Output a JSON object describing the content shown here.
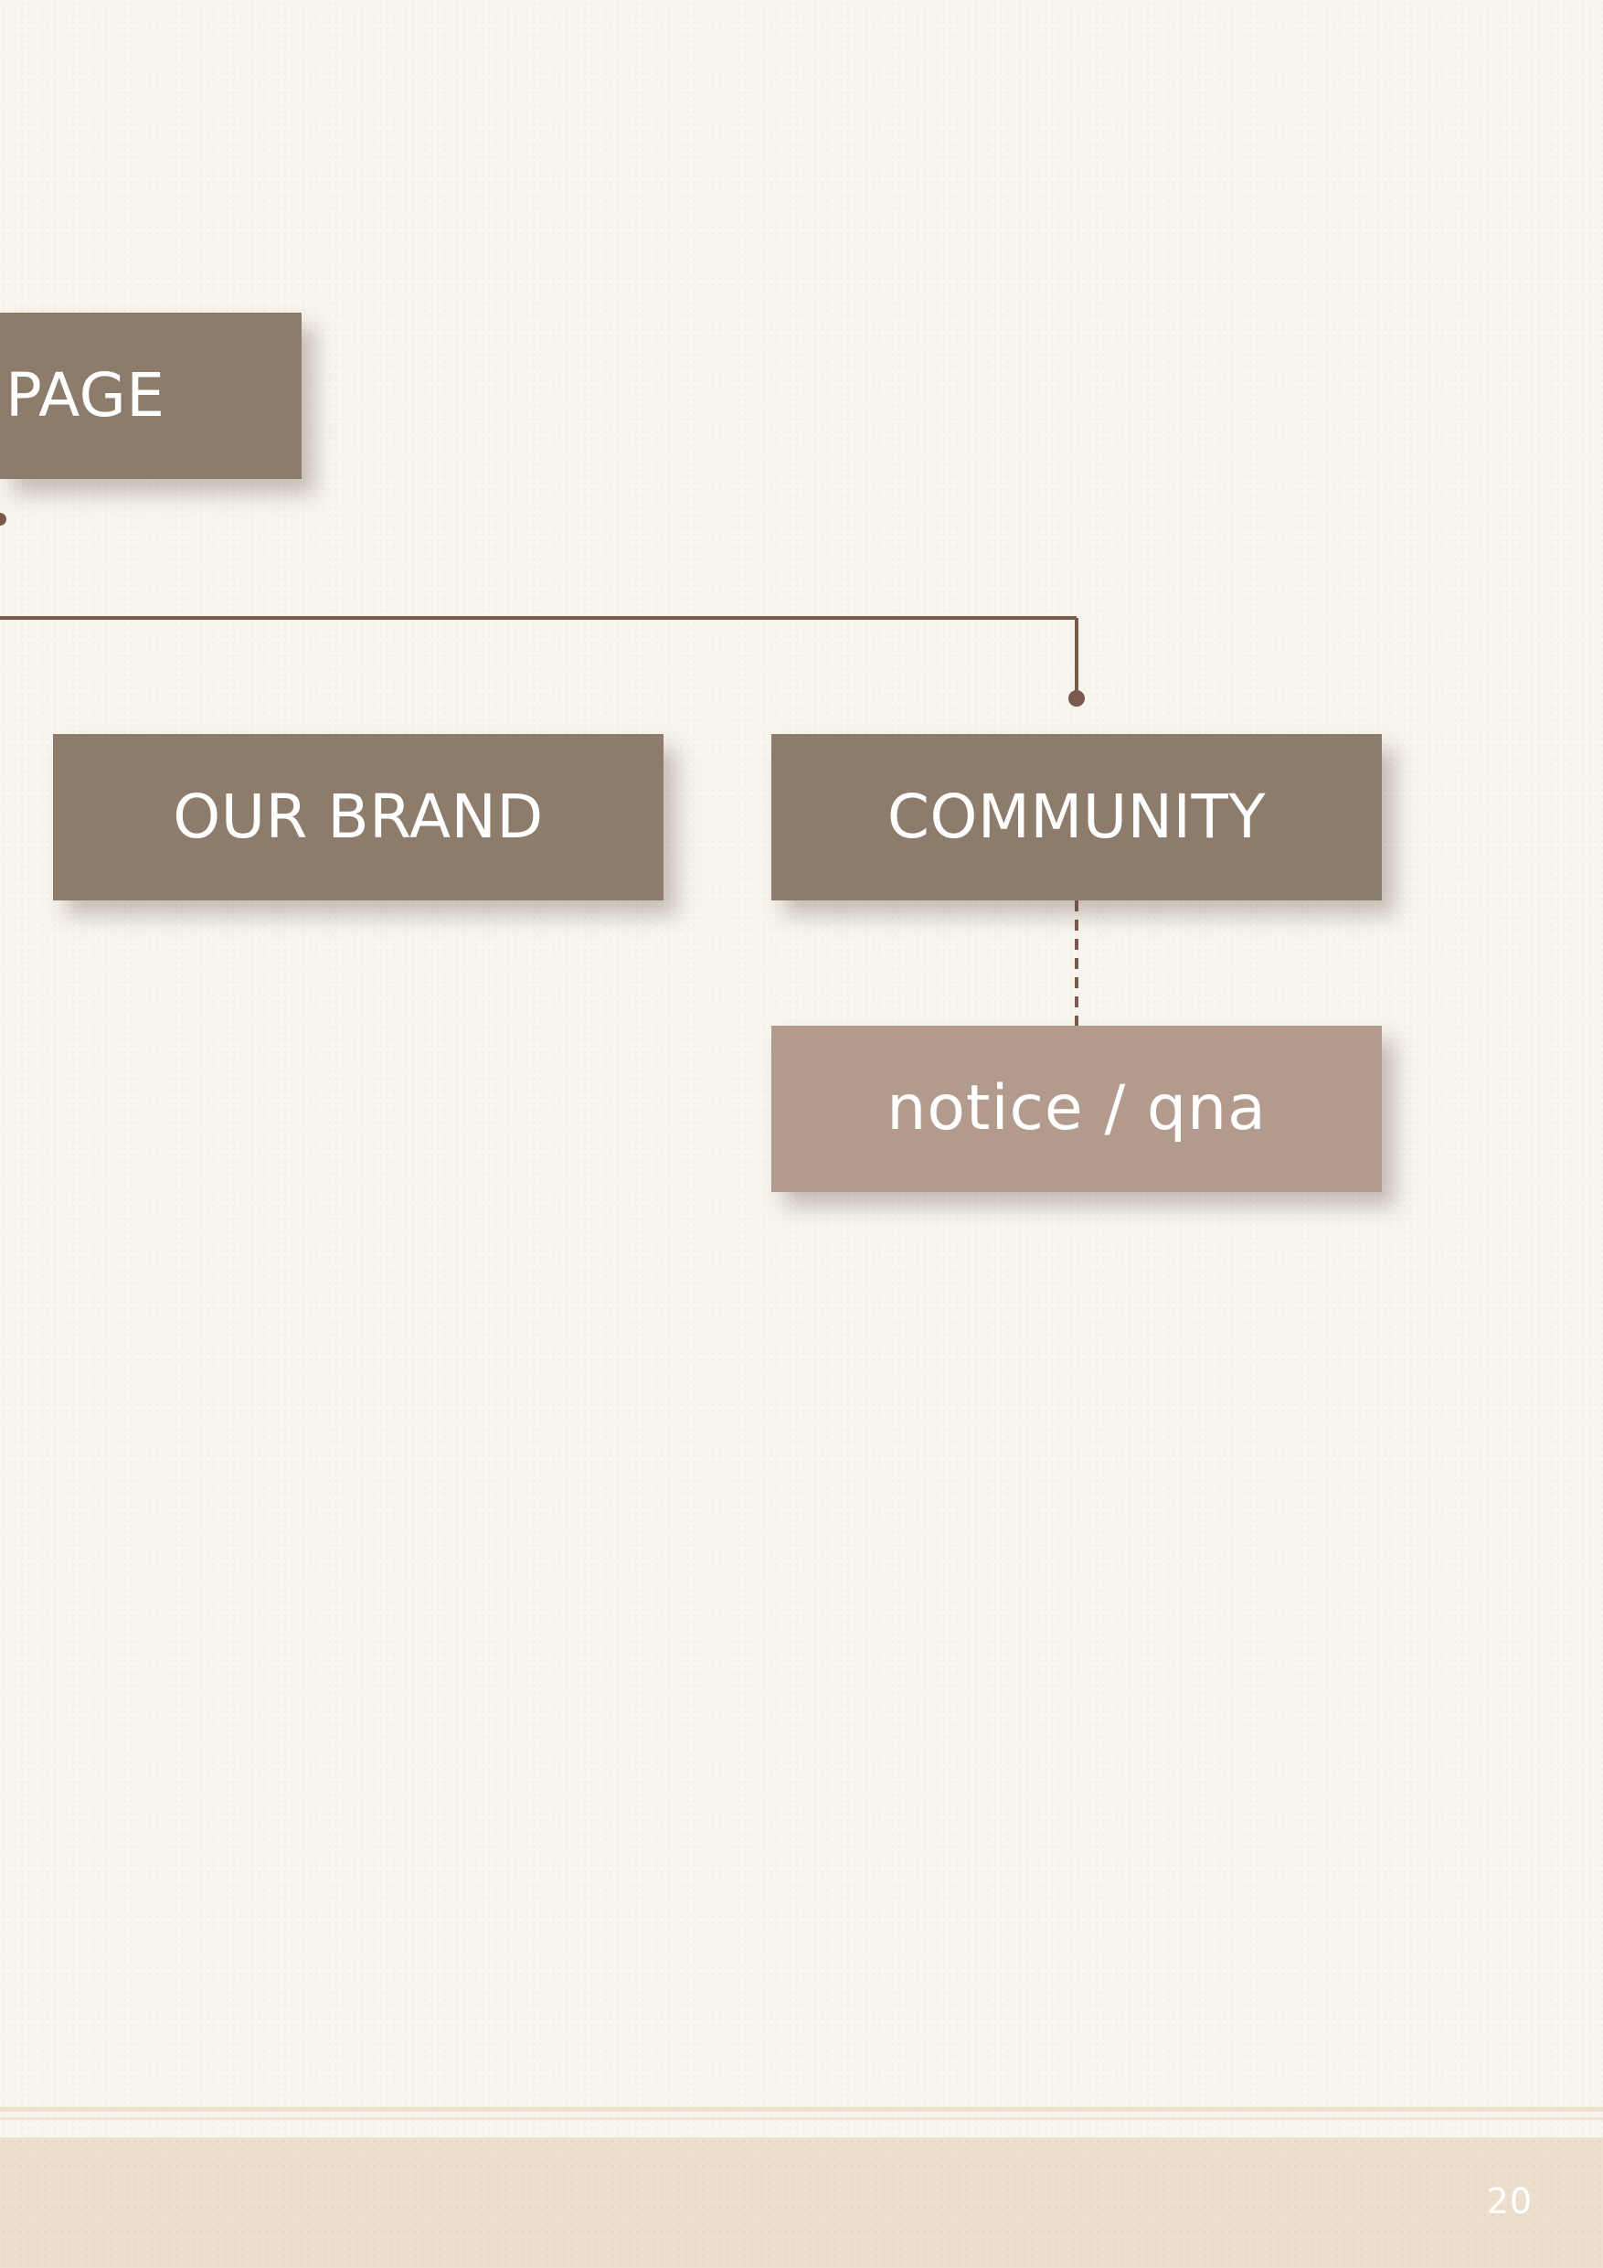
{
  "sitemap": {
    "root": {
      "label": "PAGE"
    },
    "nodes": [
      {
        "label": "OUR BRAND"
      },
      {
        "label": "COMMUNITY",
        "children": [
          {
            "label": "notice / qna"
          }
        ]
      }
    ]
  },
  "footer": {
    "page_number": "20"
  },
  "colors": {
    "box_main": "#8d7b6c",
    "box_sub": "#b29a8c",
    "connector": "#7a5a4c",
    "background": "#f8f5ef",
    "footer_band": "#eddfcd"
  }
}
